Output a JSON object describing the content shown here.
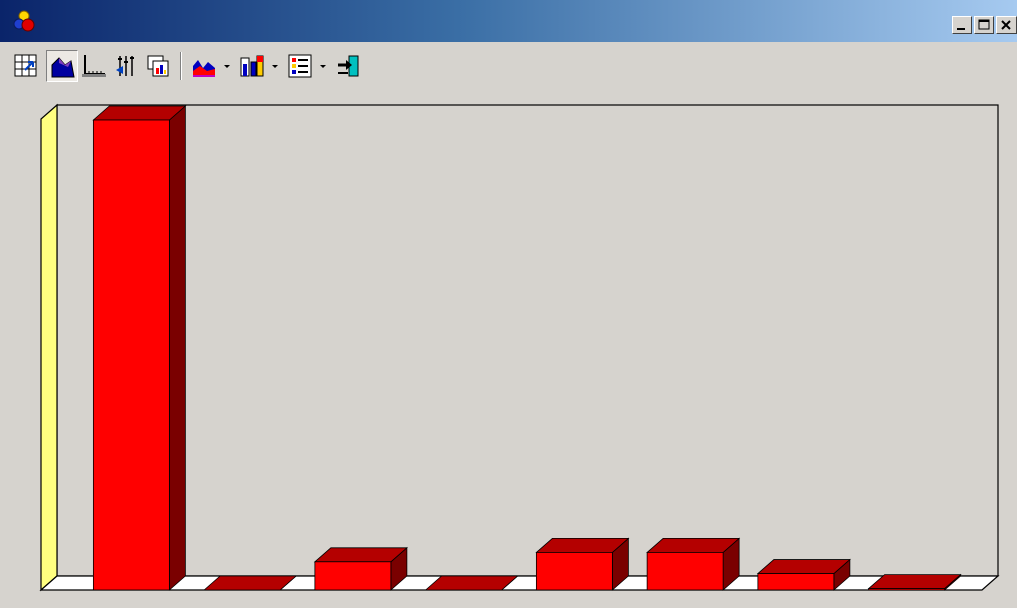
{
  "window": {
    "icons": [
      "app-icon",
      "minimize-icon",
      "maximize-icon",
      "close-icon"
    ]
  },
  "toolbar": {
    "buttons": [
      {
        "name": "data-grid-icon"
      },
      {
        "name": "3d-view-icon",
        "pressed": true
      },
      {
        "name": "axes-icon"
      },
      {
        "name": "series-order-icon"
      },
      {
        "name": "copy-chart-icon"
      },
      {
        "name": "gallery-chart-type-icon"
      },
      {
        "name": "bar-color-icon"
      },
      {
        "name": "legend-icon"
      },
      {
        "name": "export-icon"
      }
    ]
  },
  "colors": {
    "bar_front": "#ff0000",
    "bar_top": "#b40000",
    "bar_side": "#7a0000",
    "back_wall": "#d6d3ce",
    "left_wall": "#ffff80",
    "floor": "#ffffff"
  },
  "chart_data": {
    "type": "bar",
    "three_d": true,
    "categories": [
      "",
      "",
      "",
      "",
      "",
      "",
      "",
      ""
    ],
    "values": [
      100,
      0,
      6,
      0,
      8,
      8,
      3.5,
      0.3
    ],
    "ylim": [
      0,
      100
    ],
    "title": "",
    "xlabel": "",
    "ylabel": "",
    "grid": false,
    "legend": false
  }
}
